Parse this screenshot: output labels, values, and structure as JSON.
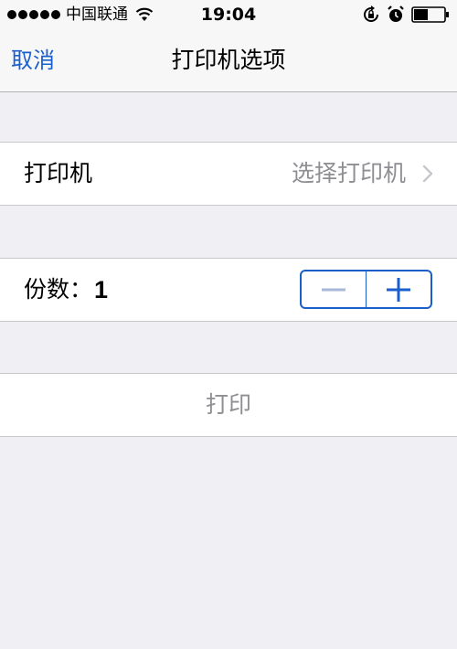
{
  "status_bar": {
    "carrier": "中国联通",
    "time": "19:04",
    "icons": [
      "signal-dots-icon",
      "wifi-icon",
      "rotation-lock-icon",
      "alarm-icon",
      "battery-icon"
    ]
  },
  "nav": {
    "cancel_label": "取消",
    "title": "打印机选项"
  },
  "printer_row": {
    "label": "打印机",
    "value": "选择打印机",
    "icon": "chevron-right-icon"
  },
  "copies_row": {
    "label": "份数：",
    "count": "1",
    "minus_icon": "minus-icon",
    "plus_icon": "plus-icon"
  },
  "print_action": {
    "label": "打印"
  },
  "colors": {
    "accent": "#1a5fcc",
    "disabled_text": "#8e8e93",
    "background": "#efeff4",
    "minus_disabled": "#a8b8d8"
  }
}
